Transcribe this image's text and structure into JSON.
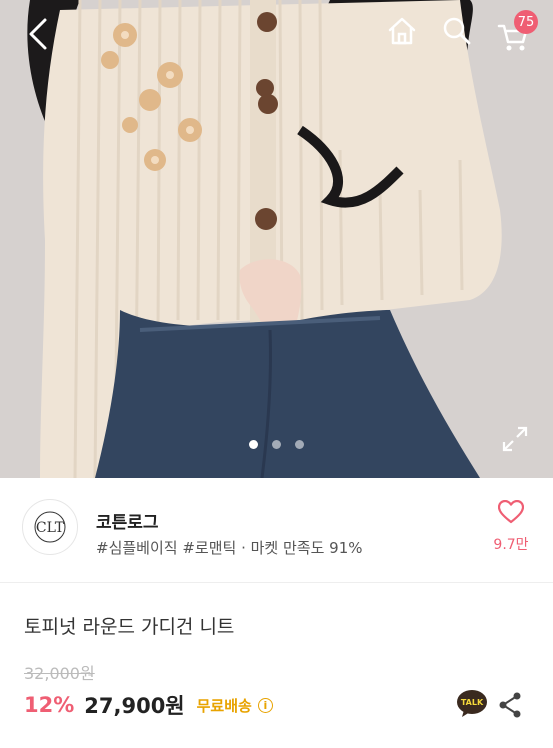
{
  "header": {
    "cart_badge": "75"
  },
  "gallery": {
    "slide_count": 3,
    "active_slide": 1
  },
  "shop": {
    "logo_text": "CLT",
    "name": "코튼로그",
    "meta": "#심플베이직 #로맨틱 · 마켓 만족도 91%",
    "likes": "9.7만"
  },
  "product": {
    "title": "토피넛 라운드 가디건 니트",
    "original_price": "32,000원",
    "discount": "12%",
    "price": "27,900원",
    "shipping": "무료배송",
    "talk_label": "TALK"
  },
  "colors": {
    "accent": "#ef5e73",
    "shipping": "#e8a300"
  }
}
